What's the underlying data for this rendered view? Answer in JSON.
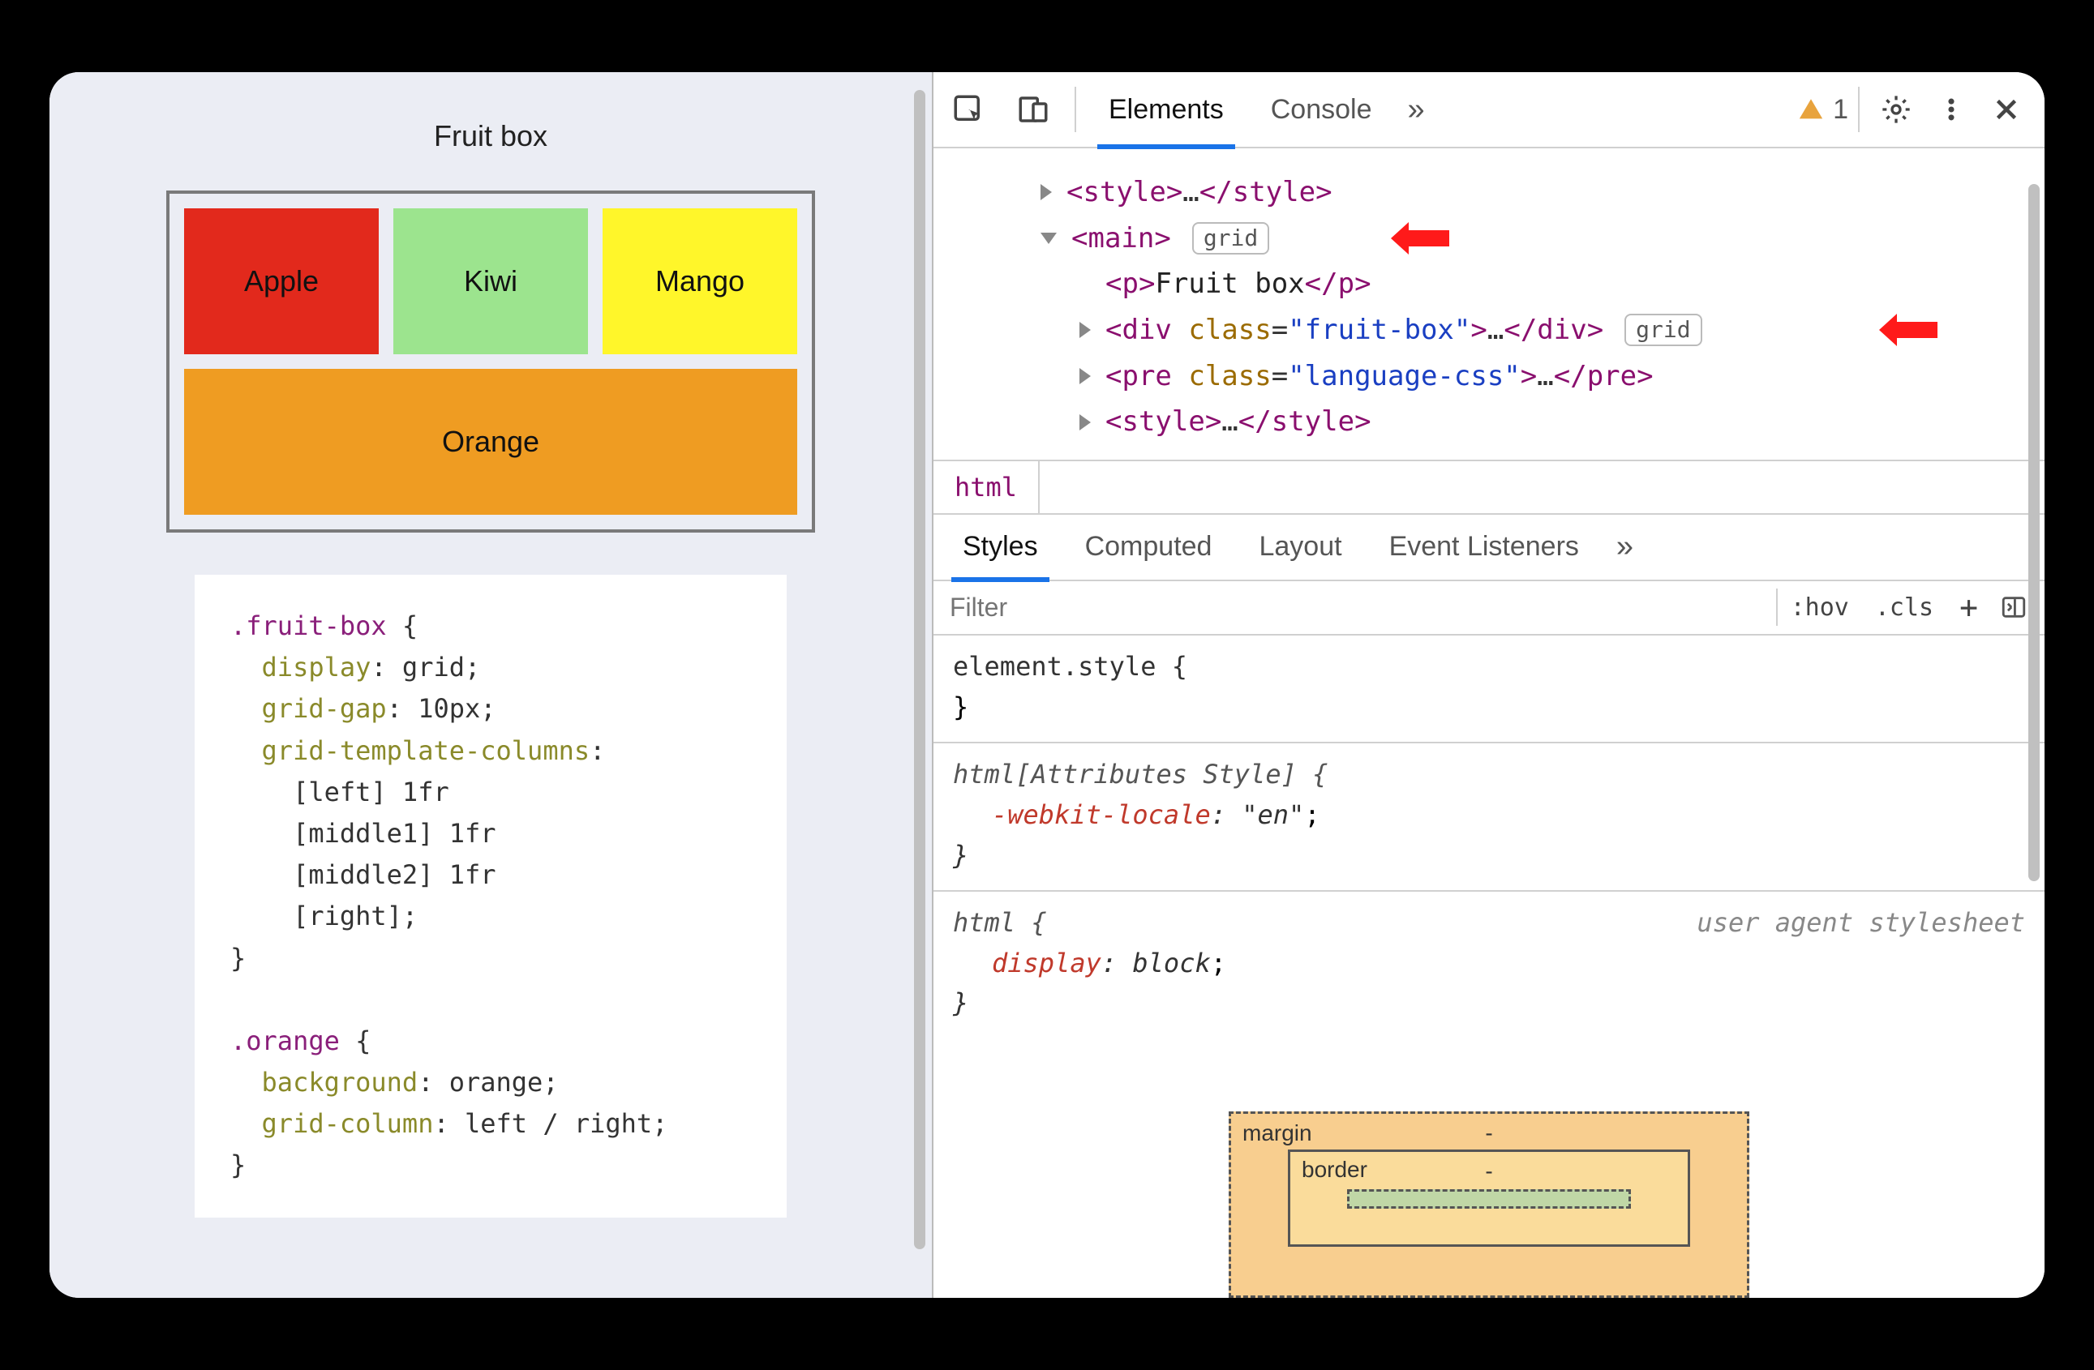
{
  "page": {
    "title": "Fruit box",
    "fruits": {
      "apple": "Apple",
      "kiwi": "Kiwi",
      "mango": "Mango",
      "orange": "Orange"
    },
    "code": {
      "sel1": ".fruit-box",
      "p1": "display",
      "v1": "grid",
      "p2": "grid-gap",
      "v2": "10px",
      "p3": "grid-template-columns",
      "l1": "[left] 1fr",
      "l2": "[middle1] 1fr",
      "l3": "[middle2] 1fr",
      "l4": "[right]",
      "sel2": ".orange",
      "p4": "background",
      "v4": "orange",
      "p5": "grid-column",
      "v5": "left / right"
    }
  },
  "devtools": {
    "tabs": {
      "elements": "Elements",
      "console": "Console",
      "overflow": "»"
    },
    "warn_count": "1",
    "dom": {
      "style_open": "<style>",
      "style_close": "</style>",
      "ellipsis": "…",
      "main_open": "<main>",
      "grid_badge": "grid",
      "p_open": "<p>",
      "p_text": "Fruit box",
      "p_close": "</p>",
      "div_open1": "<div ",
      "class_attr": "class",
      "eq": "=",
      "fruitbox_val": "\"fruit-box\"",
      "div_open2": ">",
      "div_close": "</div>",
      "pre_open1": "<pre ",
      "langcss_val": "\"language-css\"",
      "pre_close": "</pre>"
    },
    "crumb": "html",
    "subtabs": {
      "styles": "Styles",
      "computed": "Computed",
      "layout": "Layout",
      "events": "Event Listeners",
      "overflow": "»"
    },
    "filter": {
      "placeholder": "Filter",
      "hov": ":hov",
      "cls": ".cls",
      "plus": "+"
    },
    "rules": {
      "r1_sel": "element.style {",
      "r1_close": "}",
      "r2_sel": "html[Attributes Style] {",
      "r2_prop": "-webkit-locale",
      "r2_val": "\"en\"",
      "r2_close": "}",
      "r3_sel": "html {",
      "r3_origin": "user agent stylesheet",
      "r3_prop": "display",
      "r3_val": "block",
      "r3_close": "}"
    },
    "boxmodel": {
      "margin": "margin",
      "border": "border",
      "dash": "-"
    }
  }
}
